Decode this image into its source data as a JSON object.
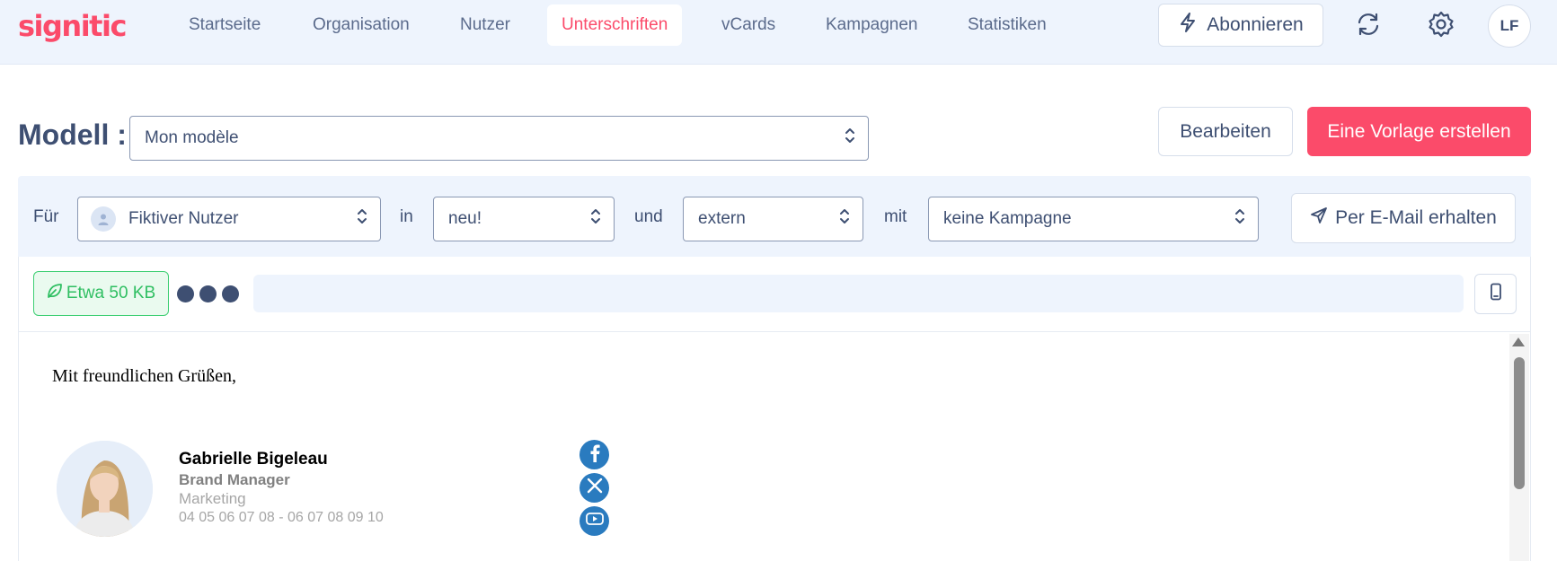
{
  "brand": {
    "logo_text": "signitic",
    "accent": "#fb4b6a"
  },
  "nav": {
    "items": [
      {
        "label": "Startseite"
      },
      {
        "label": "Organisation"
      },
      {
        "label": "Nutzer"
      },
      {
        "label": "Unterschriften",
        "active": true
      },
      {
        "label": "vCards"
      },
      {
        "label": "Kampagnen"
      },
      {
        "label": "Statistiken"
      }
    ],
    "subscribe_label": "Abonnieren",
    "subscribe_icon": "lightning-icon",
    "sync_icon": "sync-icon",
    "settings_icon": "gear-icon",
    "user_initials": "LF"
  },
  "model": {
    "label": "Modell :",
    "selected": "Mon modèle",
    "edit_label": "Bearbeiten",
    "create_label": "Eine Vorlage erstellen"
  },
  "filters": {
    "for_label": "Für",
    "user_value": "Fiktiver Nutzer",
    "in_label": "in",
    "group_value": "neu!",
    "and_label": "und",
    "type_value": "extern",
    "with_label": "mit",
    "campaign_value": "keine Kampagne",
    "email_button_label": "Per E-Mail erhalten"
  },
  "toolbar": {
    "size_label": "Etwa 50 KB",
    "size_icon": "leaf-icon",
    "mobile_icon": "mobile-icon"
  },
  "preview": {
    "greeting": "Mit freundlichen Grüßen,",
    "signature": {
      "name": "Gabrielle Bigeleau",
      "title": "Brand Manager",
      "department": "Marketing",
      "phones": "04 05 06 07 08 - 06 07 08 09 10"
    },
    "social": [
      "facebook-icon",
      "x-icon",
      "youtube-icon"
    ],
    "social_color": "#2a7bbf"
  }
}
